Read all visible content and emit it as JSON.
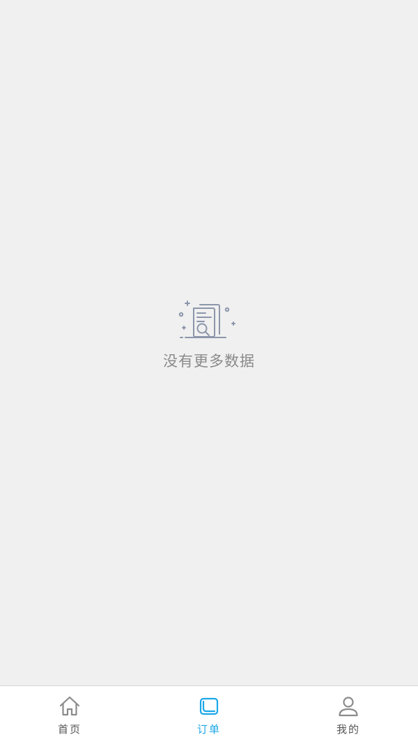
{
  "empty_state": {
    "icon": "document-search-icon",
    "message": "没有更多数据"
  },
  "tabbar": {
    "items": [
      {
        "label": "首页",
        "icon": "home-icon",
        "active": false
      },
      {
        "label": "订单",
        "icon": "order-icon",
        "active": true
      },
      {
        "label": "我的",
        "icon": "profile-icon",
        "active": false
      }
    ]
  },
  "colors": {
    "background": "#f0f0f0",
    "tabbar_background": "#ffffff",
    "active": "#1aa7e8",
    "inactive": "#555555",
    "icon_inactive": "#8a8a8a",
    "empty_text": "#8a8a8a"
  }
}
